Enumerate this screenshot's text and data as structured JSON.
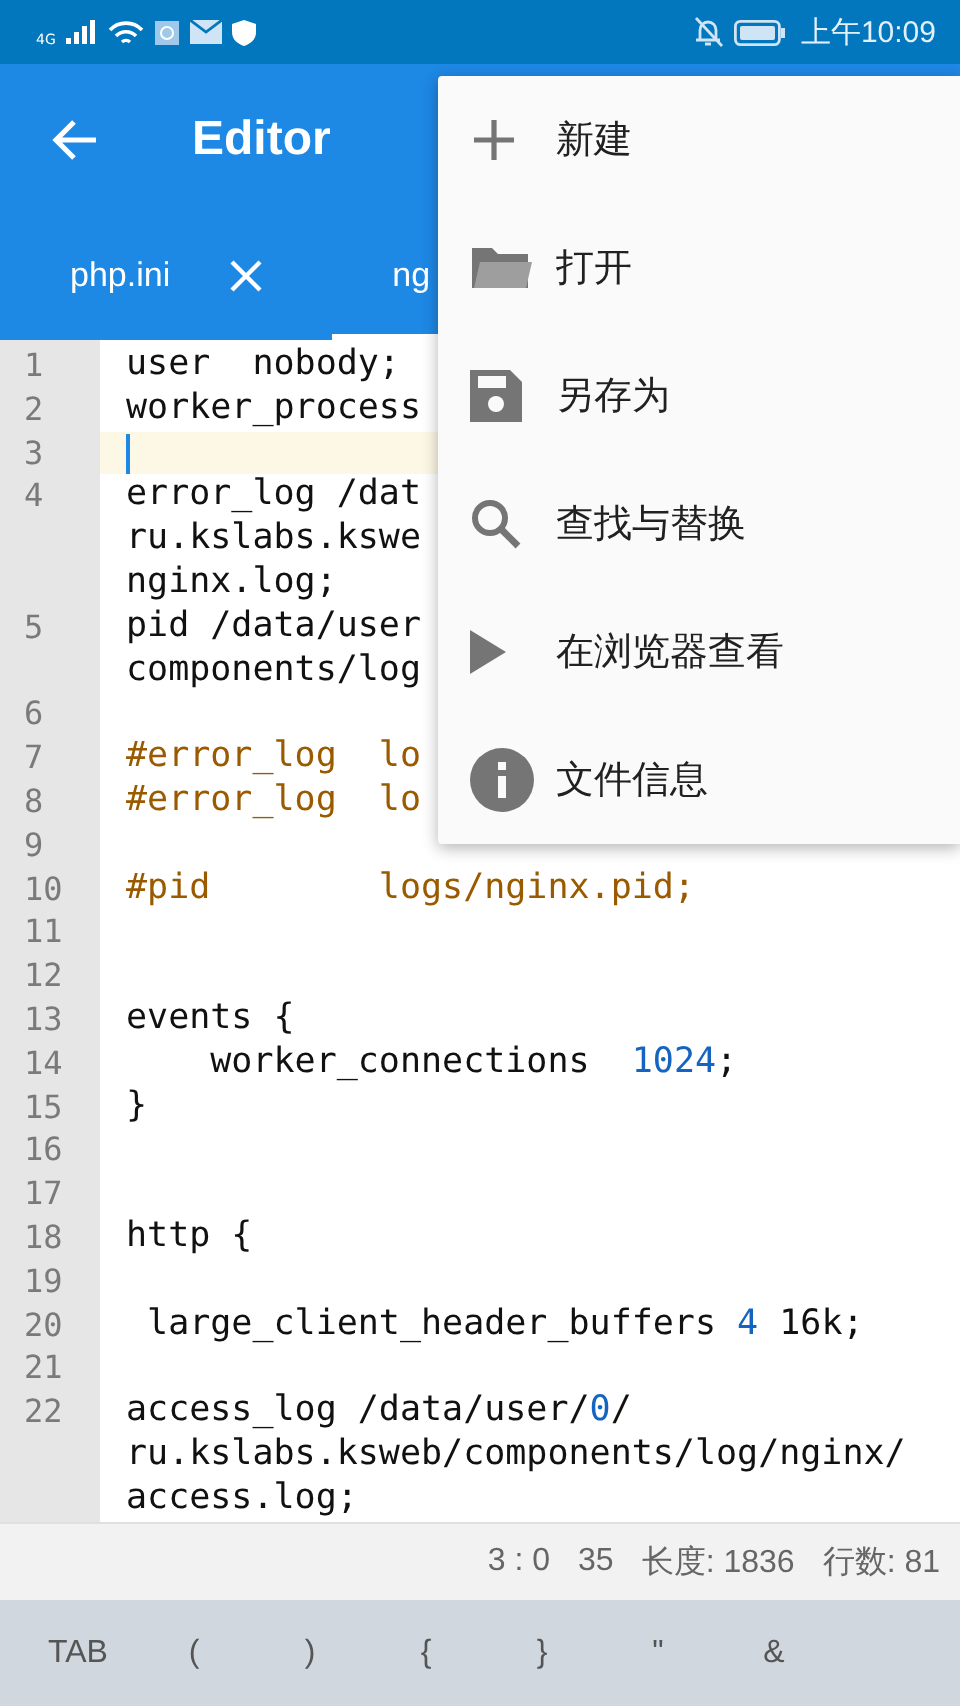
{
  "status_bar": {
    "time": "上午10:09",
    "network": "4G"
  },
  "app_bar": {
    "title": "Editor"
  },
  "tabs": [
    {
      "label": "php.ini",
      "selected": false
    },
    {
      "label": "ng",
      "selected": true
    }
  ],
  "menu": [
    {
      "label": "新建",
      "kind": "plus"
    },
    {
      "label": "打开",
      "kind": "folder"
    },
    {
      "label": "另存为",
      "kind": "save"
    },
    {
      "label": "查找与替换",
      "kind": "search"
    },
    {
      "label": "在浏览器查看",
      "kind": "play"
    },
    {
      "label": "文件信息",
      "kind": "info"
    }
  ],
  "lines": [
    {
      "number": "1",
      "current": false,
      "rows": [
        [
          {
            "t": "user  nobody;",
            "kind": "plain"
          }
        ]
      ]
    },
    {
      "number": "2",
      "current": false,
      "rows": [
        [
          {
            "t": "worker_process",
            "kind": "plain"
          }
        ]
      ]
    },
    {
      "number": "3",
      "current": true
    },
    {
      "number": "4",
      "current": false,
      "rows": [
        [
          {
            "t": "error_log /dat",
            "kind": "plain"
          }
        ],
        [
          {
            "t": "ru.kslabs.kswe",
            "kind": "plain"
          }
        ],
        [
          {
            "t": "nginx.log;",
            "kind": "plain"
          }
        ]
      ]
    },
    {
      "number": "5",
      "current": false,
      "rows": [
        [
          {
            "t": "pid /data/user",
            "kind": "plain"
          }
        ],
        [
          {
            "t": "components/log",
            "kind": "plain"
          }
        ]
      ]
    },
    {
      "number": "6",
      "current": false
    },
    {
      "number": "7",
      "current": false,
      "rows": [
        [
          {
            "t": "#error_log  lo",
            "kind": "comment"
          }
        ]
      ]
    },
    {
      "number": "8",
      "current": false,
      "rows": [
        [
          {
            "t": "#error_log  lo",
            "kind": "comment"
          }
        ]
      ]
    },
    {
      "number": "9",
      "current": false
    },
    {
      "number": "10",
      "current": false,
      "rows": [
        [
          {
            "t": "#pid        logs/nginx.pid;",
            "kind": "comment"
          }
        ]
      ]
    },
    {
      "number": "11",
      "current": false
    },
    {
      "number": "12",
      "current": false
    },
    {
      "number": "13",
      "current": false,
      "rows": [
        [
          {
            "t": "events {",
            "kind": "plain"
          }
        ]
      ]
    },
    {
      "number": "14",
      "current": false,
      "rows": [
        [
          {
            "t": "    worker_connections  ",
            "kind": "plain"
          },
          {
            "t": "1024",
            "kind": "number"
          },
          {
            "t": ";",
            "kind": "plain"
          }
        ]
      ]
    },
    {
      "number": "15",
      "current": false,
      "rows": [
        [
          {
            "t": "}",
            "kind": "plain"
          }
        ]
      ]
    },
    {
      "number": "16",
      "current": false
    },
    {
      "number": "17",
      "current": false
    },
    {
      "number": "18",
      "current": false,
      "rows": [
        [
          {
            "t": "http {",
            "kind": "plain"
          }
        ]
      ]
    },
    {
      "number": "19",
      "current": false
    },
    {
      "number": "20",
      "current": false,
      "rows": [
        [
          {
            "t": " large_client_header_buffers ",
            "kind": "plain"
          },
          {
            "t": "4",
            "kind": "number"
          },
          {
            "t": " 16k;",
            "kind": "plain"
          }
        ]
      ]
    },
    {
      "number": "21",
      "current": false
    },
    {
      "number": "22",
      "current": false,
      "rows": [
        [
          {
            "t": "access_log /data/user/",
            "kind": "plain"
          },
          {
            "t": "0",
            "kind": "number"
          },
          {
            "t": "/",
            "kind": "plain"
          }
        ],
        [
          {
            "t": "ru.kslabs.ksweb/components/log/nginx/",
            "kind": "plain"
          }
        ],
        [
          {
            "t": "access.log;",
            "kind": "plain"
          }
        ]
      ]
    }
  ],
  "info_bar": [
    "3 : 0",
    "35",
    "长度: 1836",
    "行数: 81"
  ],
  "keys": [
    "TAB",
    "(",
    ")",
    "{",
    "}",
    "\"",
    "&"
  ]
}
